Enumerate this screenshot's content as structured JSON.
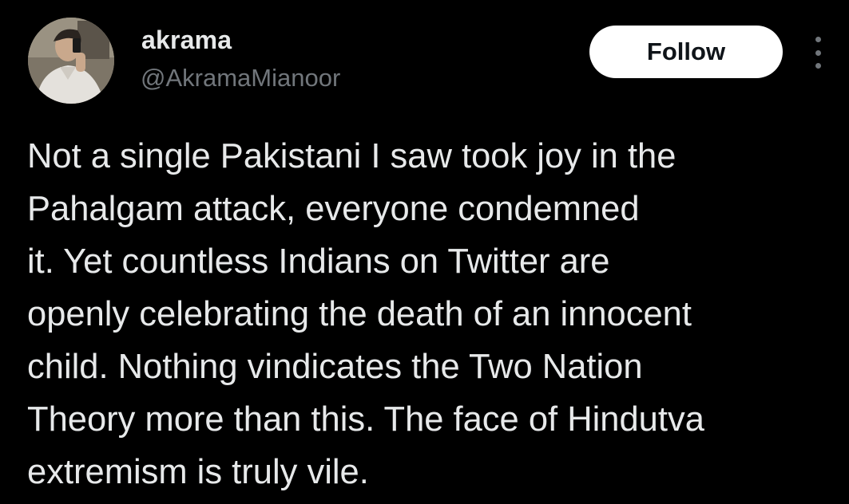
{
  "user": {
    "display_name": "akrama",
    "handle": "@AkramaMianoor"
  },
  "actions": {
    "follow_label": "Follow",
    "more_icon": "more-vertical-icon"
  },
  "tweet": {
    "lines": [
      "Not a single Pakistani I saw took joy in the",
      "Pahalgam attack, everyone condemned",
      "it. Yet countless Indians on Twitter are",
      "openly celebrating the death of an innocent",
      "child. Nothing vindicates the Two Nation",
      "Theory more than this. The face of Hindutva",
      "extremism is truly vile."
    ]
  },
  "colors": {
    "background": "#000000",
    "primary_text": "#e7e9ea",
    "secondary_text": "#71767b",
    "button_bg": "#ffffff",
    "button_text": "#0f1419"
  }
}
